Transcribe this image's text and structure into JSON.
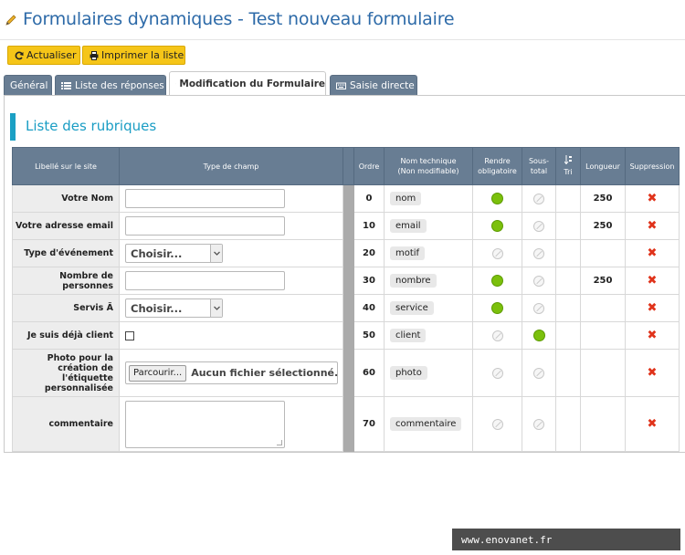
{
  "title": "Formulaires dynamiques - Test nouveau formulaire",
  "toolbar": {
    "refresh_label": "Actualiser",
    "print_label": "Imprimer la liste"
  },
  "tabs": [
    {
      "label": "Général"
    },
    {
      "label": "Liste des réponses"
    },
    {
      "label": "Modification du Formulaire"
    },
    {
      "label": "Saisie directe"
    }
  ],
  "section_title": "Liste des rubriques",
  "table": {
    "headers": {
      "label": "Libellé sur le site",
      "type": "Type de champ",
      "order": "Ordre",
      "tech_1": "Nom technique",
      "tech_2": "(Non modifiable)",
      "required_1": "Rendre",
      "required_2": "obligatoire",
      "subtotal_1": "Sous-",
      "subtotal_2": "total",
      "sort": "Tri",
      "length": "Longueur",
      "delete": "Suppression"
    },
    "rows": [
      {
        "label": "Votre Nom",
        "field": "text",
        "order": "0",
        "tech": "nom",
        "required": true,
        "subtotal": false,
        "length": "250"
      },
      {
        "label": "Votre adresse email",
        "field": "text",
        "order": "10",
        "tech": "email",
        "required": true,
        "subtotal": false,
        "length": "250"
      },
      {
        "label": "Type d'événement",
        "field": "select",
        "select_value": "Choisir...",
        "order": "20",
        "tech": "motif",
        "required": false,
        "subtotal": false,
        "length": ""
      },
      {
        "label": "Nombre de personnes",
        "field": "text",
        "order": "30",
        "tech": "nombre",
        "required": true,
        "subtotal": false,
        "length": "250"
      },
      {
        "label": "Servis Ã",
        "field": "select",
        "select_value": "Choisir...",
        "order": "40",
        "tech": "service",
        "required": true,
        "subtotal": false,
        "length": ""
      },
      {
        "label": "Je suis déjà  client",
        "field": "checkbox",
        "order": "50",
        "tech": "client",
        "required": false,
        "subtotal": true,
        "length": ""
      },
      {
        "label": "Photo pour la création de l'étiquette personnalisée",
        "field": "file",
        "file_button": "Parcourir...",
        "file_text": "Aucun fichier sélectionné.",
        "order": "60",
        "tech": "photo",
        "required": false,
        "subtotal": false,
        "length": ""
      },
      {
        "label": "commentaire",
        "field": "textarea",
        "order": "70",
        "tech": "commentaire",
        "required": false,
        "subtotal": false,
        "length": ""
      }
    ]
  },
  "delete_glyph": "✖",
  "watermark": "www.enovanet.fr",
  "colors": {
    "title": "#2d6aa8",
    "accent": "#1ba0c4",
    "button": "#f5c518",
    "tab": "#687d93",
    "required_dot": "#7bc00c",
    "delete": "#e0331b"
  }
}
